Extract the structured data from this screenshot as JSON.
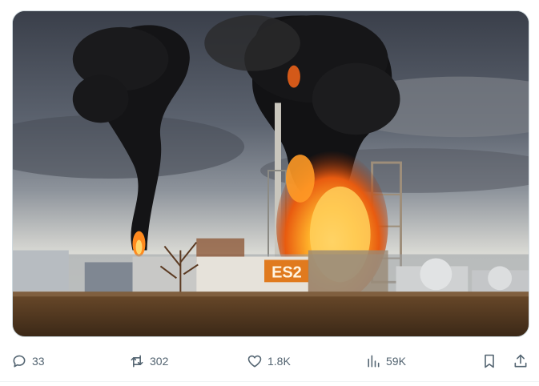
{
  "media": {
    "image_sign_text": "ES2"
  },
  "actions": {
    "replies": "33",
    "reposts": "302",
    "likes": "1.8K",
    "views": "59K"
  }
}
